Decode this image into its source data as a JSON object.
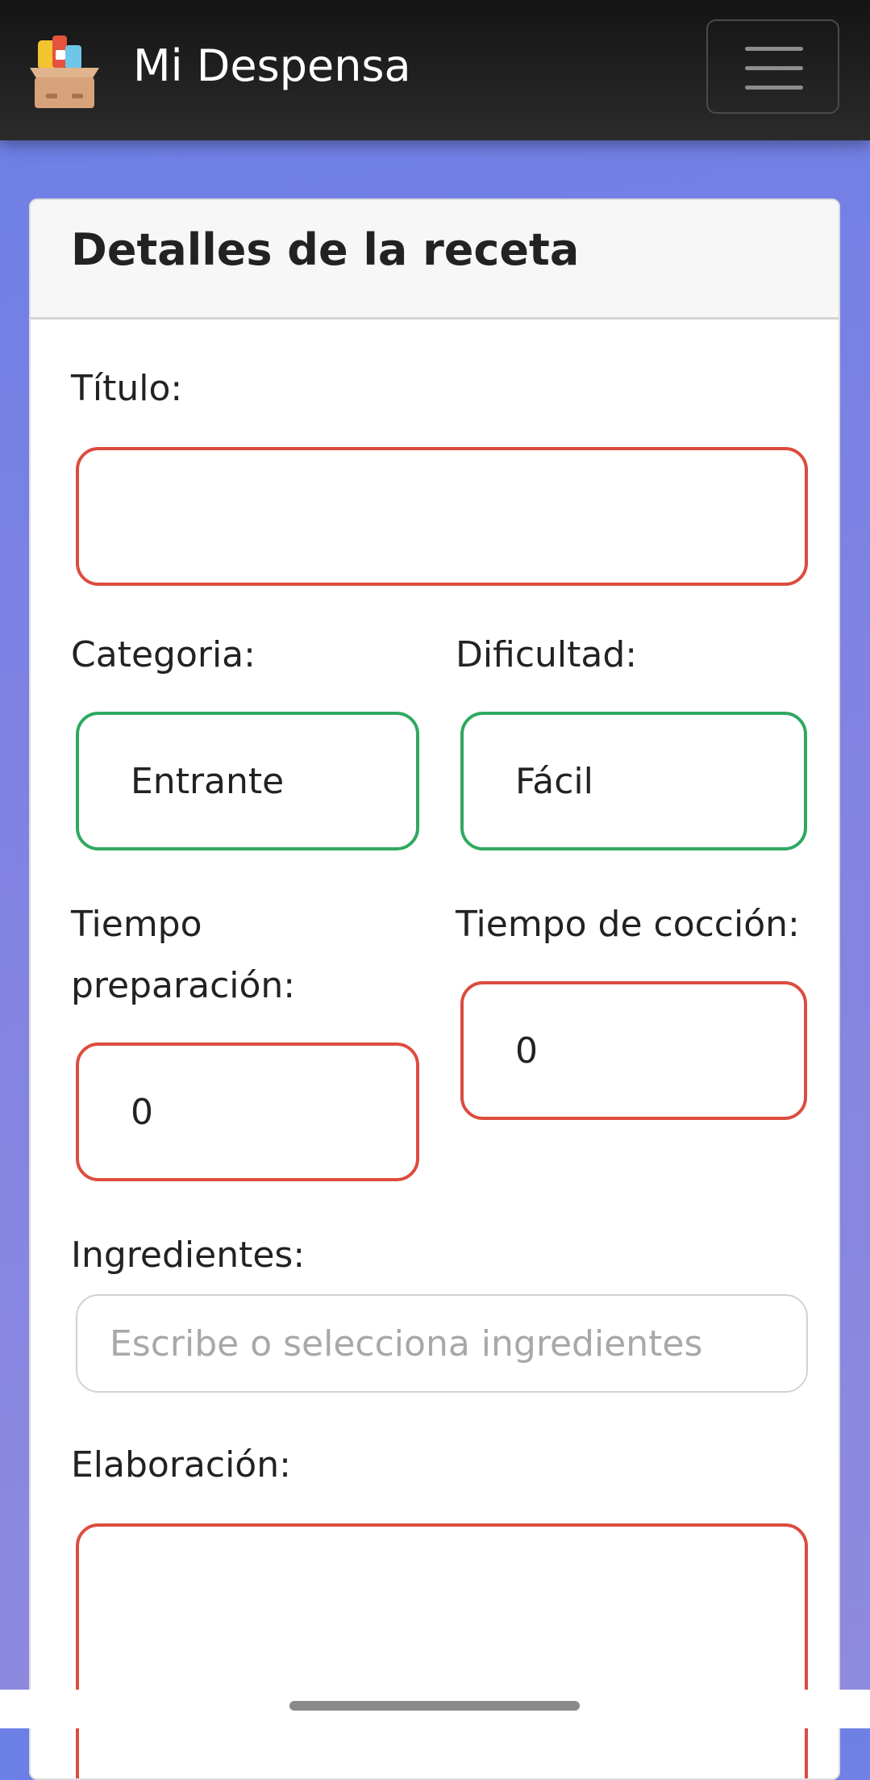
{
  "app": {
    "title": "Mi Despensa",
    "logo_icon": "pantry-box-icon",
    "menu_icon": "hamburger-menu-icon"
  },
  "card": {
    "title": "Detalles de la receta"
  },
  "form": {
    "titulo": {
      "label": "Título:",
      "value": ""
    },
    "categoria": {
      "label": "Categoria:",
      "value": "Entrante"
    },
    "dificultad": {
      "label": "Dificultad:",
      "value": "Fácil"
    },
    "tiempo_preparacion": {
      "label_line1": "Tiempo",
      "label_line2": "preparación:",
      "value": "0"
    },
    "tiempo_coccion": {
      "label": "Tiempo de cocción:",
      "value": "0"
    },
    "ingredientes": {
      "label": "Ingredientes:",
      "placeholder": "Escribe o selecciona ingredientes"
    },
    "elaboracion": {
      "label": "Elaboración:",
      "value": ""
    }
  },
  "colors": {
    "invalid_border": "#dc4c3e",
    "valid_border": "#2fa861",
    "navbar": "#1c1c1c",
    "background_gradient": "#6b7fe6"
  }
}
